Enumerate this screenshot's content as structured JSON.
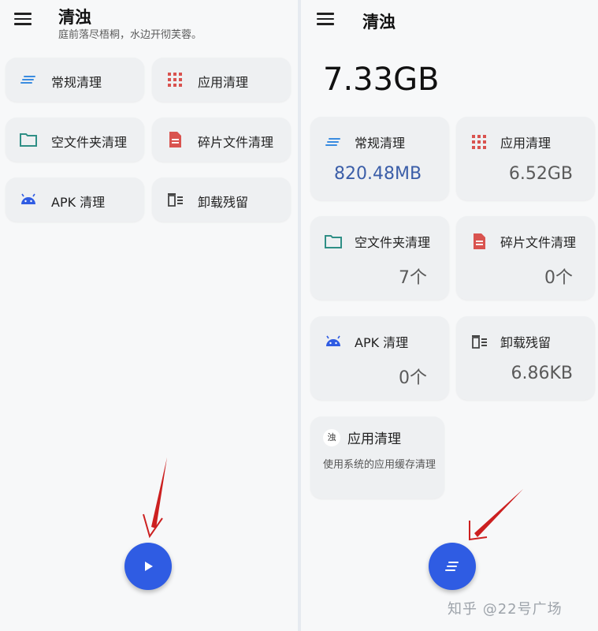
{
  "colors": {
    "accent": "#2f5ce3",
    "arrow": "#cc2020",
    "general": "#3a8ce0",
    "app": "#d9534f",
    "folder": "#2f8f86",
    "fragment": "#d9534f",
    "apk": "#2f5ce3",
    "uninstall": "#444444"
  },
  "left": {
    "title": "清浊",
    "subtitle": "庭前落尽梧桐，水边开彻芙蓉。",
    "cards": [
      {
        "label": "常规清理",
        "icon": "lines-icon"
      },
      {
        "label": "应用清理",
        "icon": "grid-icon"
      },
      {
        "label": "空文件夹清理",
        "icon": "folder-icon"
      },
      {
        "label": "碎片文件清理",
        "icon": "file-icon"
      },
      {
        "label": "APK 清理",
        "icon": "android-icon"
      },
      {
        "label": "卸载残留",
        "icon": "trash-list-icon"
      }
    ],
    "fab_icon": "play-icon"
  },
  "right": {
    "title": "清浊",
    "total": "7.33GB",
    "cards": [
      {
        "label": "常规清理",
        "value": "820.48MB",
        "icon": "lines-icon"
      },
      {
        "label": "应用清理",
        "value": "6.52GB",
        "icon": "grid-icon"
      },
      {
        "label": "空文件夹清理",
        "value": "7个",
        "icon": "folder-icon"
      },
      {
        "label": "碎片文件清理",
        "value": "0个",
        "icon": "file-icon"
      },
      {
        "label": "APK 清理",
        "value": "0个",
        "icon": "android-icon"
      },
      {
        "label": "卸载残留",
        "value": "6.86KB",
        "icon": "trash-list-icon"
      }
    ],
    "extra_card": {
      "badge": "浊",
      "label": "应用清理",
      "desc": "使用系统的应用缓存清理"
    },
    "fab_icon": "lines-icon"
  },
  "watermark": "知乎 @22号广场"
}
